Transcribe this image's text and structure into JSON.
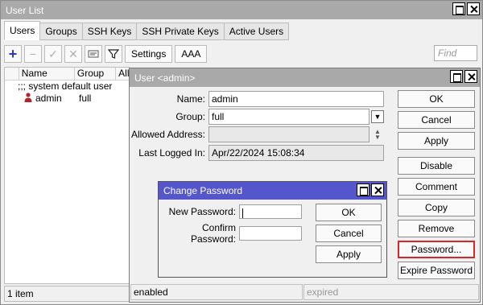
{
  "main": {
    "title": "User List",
    "tabs": [
      "Users",
      "Groups",
      "SSH Keys",
      "SSH Private Keys",
      "Active Users"
    ],
    "toolbar": {
      "settings_label": "Settings",
      "aaa_label": "AAA",
      "find_placeholder": "Find"
    },
    "columns": [
      "Name",
      "Group",
      "All"
    ],
    "rows": {
      "comment": ";;; system default user",
      "name": "admin",
      "group": "full"
    },
    "status": "1 item"
  },
  "user_window": {
    "title": "User <admin>",
    "fields": {
      "name_label": "Name:",
      "name_value": "admin",
      "group_label": "Group:",
      "group_value": "full",
      "allowed_label": "Allowed Address:",
      "allowed_value": "",
      "last_logged_label": "Last Logged In:",
      "last_logged_value": "Apr/22/2024 15:08:34"
    },
    "buttons": {
      "ok": "OK",
      "cancel": "Cancel",
      "apply": "Apply",
      "disable": "Disable",
      "comment": "Comment",
      "copy": "Copy",
      "remove": "Remove",
      "password": "Password...",
      "expire_password": "Expire Password"
    },
    "status_left": "enabled",
    "status_right": "expired"
  },
  "password_dialog": {
    "title": "Change Password",
    "new_label": "New Password:",
    "confirm_label": "Confirm Password:",
    "new_value": "",
    "confirm_value": "",
    "ok": "OK",
    "cancel": "Cancel",
    "apply": "Apply"
  },
  "colors": {
    "accent_blue": "#1a3fc4",
    "user_icon_red": "#b0242a",
    "dialog_title": "#5555cc",
    "highlight_red": "#d62828"
  }
}
